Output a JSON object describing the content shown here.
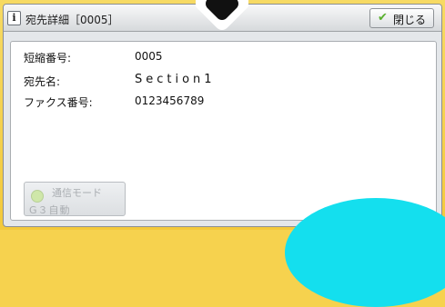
{
  "dialog": {
    "title": "宛先詳細［0005］",
    "close_label": "閉じる"
  },
  "fields": [
    {
      "label": "短縮番号:",
      "value": "0005"
    },
    {
      "label": "宛先名:",
      "value": "Section1"
    },
    {
      "label": "ファクス番号:",
      "value": "0123456789"
    }
  ],
  "mode_button": {
    "line1": "通信モード",
    "line2": "G３自動"
  },
  "icons": {
    "info": "info-icon",
    "check": "checkmark-icon",
    "arrow": "down-arrow-icon",
    "mode": "communication-mode-icon"
  },
  "colors": {
    "background": "#f6d24e",
    "accent": "#14dfee",
    "check": "#5ab02f"
  }
}
